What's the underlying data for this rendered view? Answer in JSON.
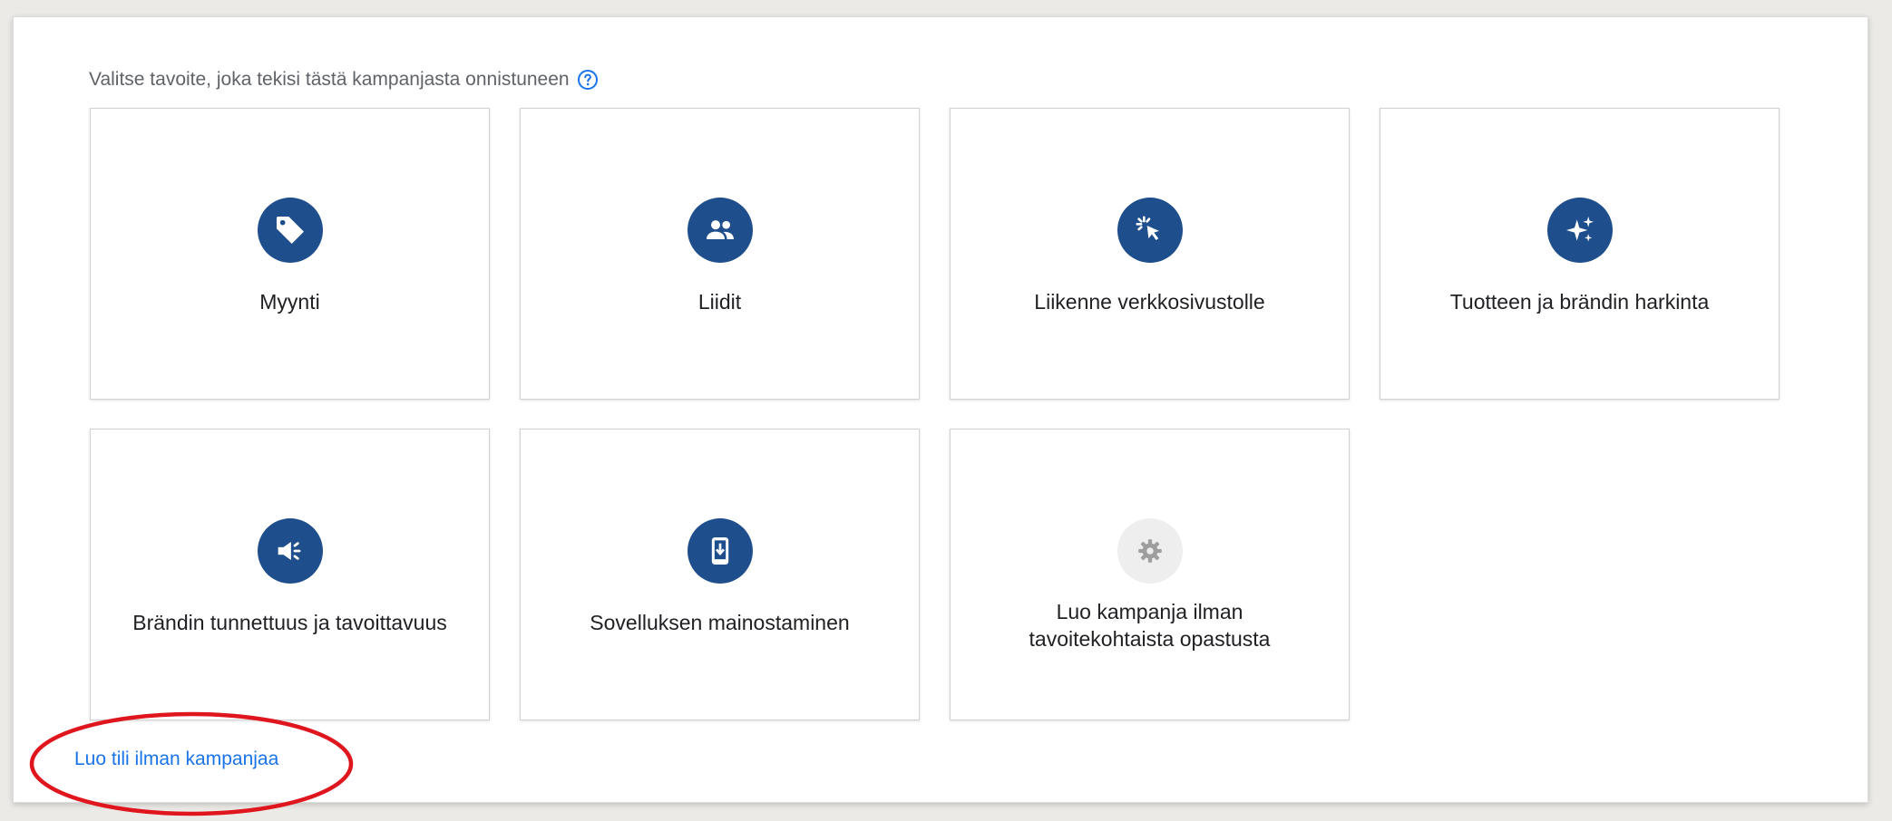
{
  "prompt": {
    "text": "Valitse tavoite, joka tekisi tästä kampanjasta onnistuneen",
    "help_icon": "help-circle-icon"
  },
  "goals": [
    {
      "label": "Myynti",
      "icon": "tag-icon"
    },
    {
      "label": "Liidit",
      "icon": "people-icon"
    },
    {
      "label": "Liikenne verkkosivustolle",
      "icon": "cursor-click-icon"
    },
    {
      "label": "Tuotteen ja brändin harkinta",
      "icon": "sparkle-icon"
    },
    {
      "label": "Brändin tunnettuus ja tavoittavuus",
      "icon": "megaphone-icon"
    },
    {
      "label": "Sovelluksen mainostaminen",
      "icon": "phone-download-icon"
    },
    {
      "label": "Luo kampanja ilman tavoitekohtaista opastusta",
      "icon": "gear-icon"
    }
  ],
  "footer": {
    "link_label": "Luo tili ilman kampanjaa"
  },
  "colors": {
    "icon_bg": "#1f4e8c",
    "link": "#1a73e8",
    "annotation": "#e0161e"
  }
}
